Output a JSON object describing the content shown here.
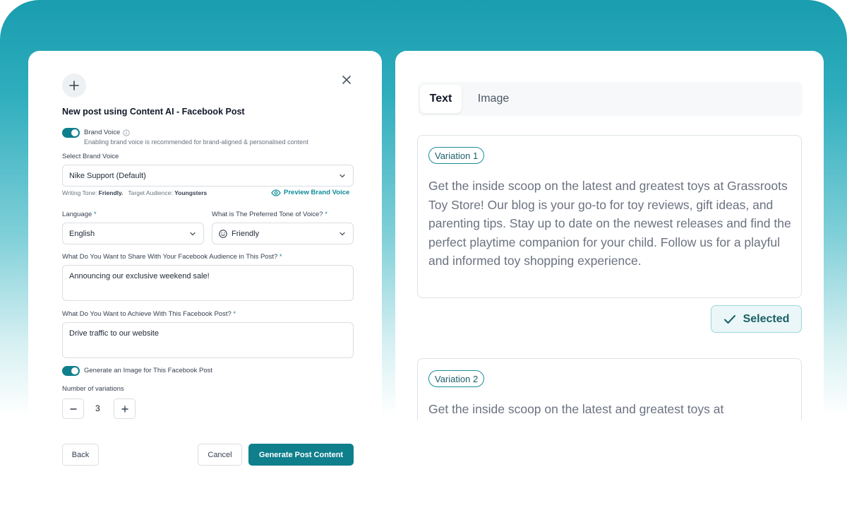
{
  "form": {
    "title": "New post using Content AI - Facebook Post",
    "brand_voice_label": "Brand Voice",
    "brand_voice_hint": "Enabling brand voice is recommended for brand-aligned & personalised content",
    "select_brand_voice_label": "Select Brand Voice",
    "brand_voice_value": "Nike Support (Default)",
    "writing_tone_label": "Writing Tone:",
    "writing_tone_value": "Friendly.",
    "target_audience_label": "Target Audience:",
    "target_audience_value": "Youngsters",
    "preview_brand_voice": "Preview Brand Voice",
    "language_label": "Language",
    "language_value": "English",
    "tone_label": "What is The Preferred Tone of Voice?",
    "tone_value": "Friendly",
    "share_label": "What Do You Want to Share With Your Facebook Audience in This Post?",
    "share_value": "Announcing our exclusive weekend sale!",
    "achieve_label": "What Do You Want to Achieve With This Facebook Post?",
    "achieve_value": "Drive traffic to our website",
    "generate_image_label": "Generate an Image for This Facebook Post",
    "variations_label": "Number of variations",
    "variations_value": "3",
    "required_mark": "*",
    "back_label": "Back",
    "cancel_label": "Cancel",
    "generate_label": "Generate Post Content",
    "brand_voice_enabled": true,
    "generate_image_enabled": true
  },
  "results": {
    "tabs": [
      {
        "label": "Text",
        "active": true
      },
      {
        "label": "Image",
        "active": false
      }
    ],
    "variations": [
      {
        "label": "Variation 1",
        "text": "Get the inside scoop on the latest and greatest toys at Grassroots Toy Store! Our blog is your go-to for toy reviews, gift ideas, and parenting tips. Stay up to date on the newest releases and find the perfect playtime companion for your child. Follow us for a playful and informed toy shopping experience."
      },
      {
        "label": "Variation 2",
        "text": "Get the inside scoop on the latest and greatest toys at"
      }
    ],
    "selected_label": "Selected"
  },
  "icons": {
    "add": "plus-icon",
    "close": "close-icon",
    "info": "info-icon",
    "chevron": "chevron-down-icon",
    "preview": "eye-icon",
    "tone": "smiley-icon",
    "minus": "minus-icon",
    "check": "check-icon"
  },
  "colors": {
    "accent": "#0f7f8c",
    "header_gradient": "#199daf"
  }
}
